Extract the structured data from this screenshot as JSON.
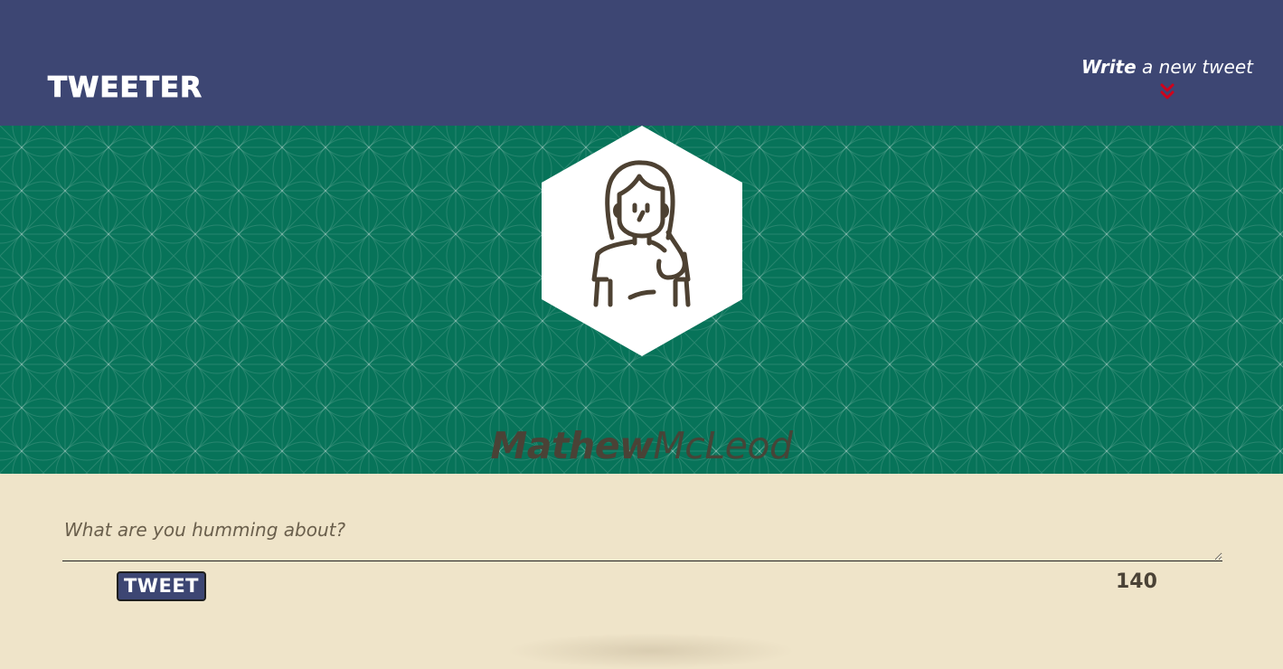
{
  "nav": {
    "brand": "Tweeter",
    "compose_toggle": {
      "strong": "Write",
      "rest": " a new tweet",
      "icon": "double-chevron-down-icon"
    }
  },
  "profile": {
    "first_name": "Mathew",
    "last_name": "McLeod",
    "avatar_icon": "woman-avatar-icon"
  },
  "compose": {
    "placeholder": "What are you humming about?",
    "value": "",
    "submit_label": "Tweet",
    "char_count": "140"
  },
  "colors": {
    "nav_bg": "#3d4673",
    "banner_bg": "#077359",
    "page_bg": "#efe4c9",
    "accent_red": "#d0021b",
    "text_dark": "#4a4236"
  }
}
